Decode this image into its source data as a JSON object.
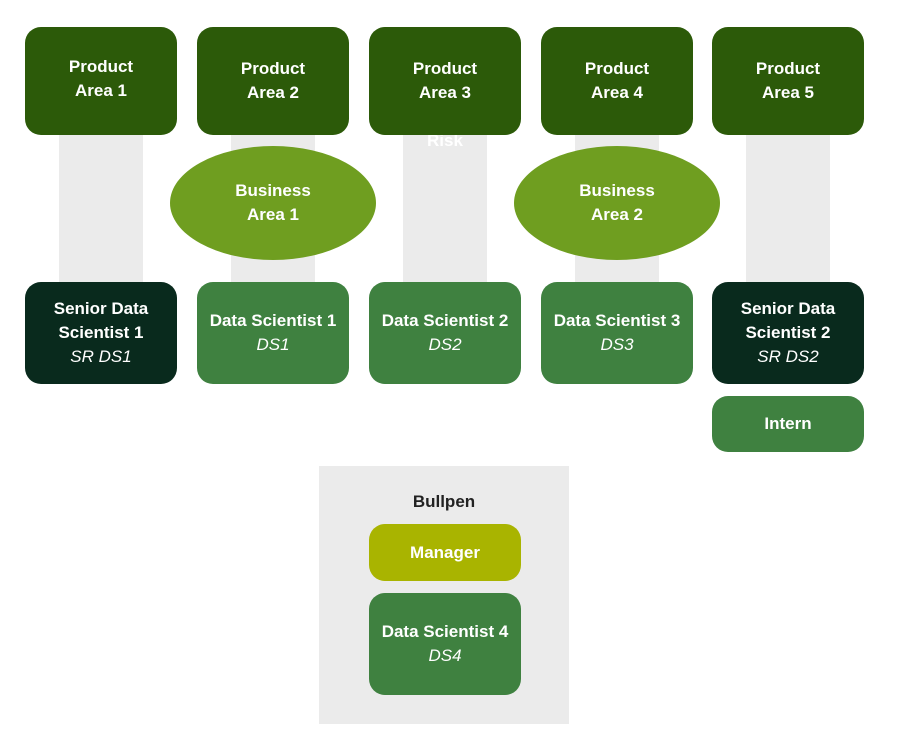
{
  "product_areas": [
    {
      "line1": "Product",
      "line2": "Area 1"
    },
    {
      "line1": "Product",
      "line2": "Area 2"
    },
    {
      "line1": "Product",
      "line2": "Area 3"
    },
    {
      "line1": "Product",
      "line2": "Area 4"
    },
    {
      "line1": "Product",
      "line2": "Area 5"
    }
  ],
  "hidden_label": "Risk",
  "business_areas": [
    {
      "line1": "Business",
      "line2": "Area 1"
    },
    {
      "line1": "Business",
      "line2": "Area 2"
    }
  ],
  "people": [
    {
      "title": "Senior Data Scientist 1",
      "code": "SR DS1"
    },
    {
      "title": "Data Scientist 1",
      "code": "DS1"
    },
    {
      "title": "Data Scientist 2",
      "code": "DS2"
    },
    {
      "title": "Data Scientist 3",
      "code": "DS3"
    },
    {
      "title": "Senior Data Scientist 2",
      "code": "SR DS2"
    }
  ],
  "intern": "Intern",
  "bullpen": {
    "title": "Bullpen",
    "manager": "Manager",
    "member": {
      "title": "Data Scientist 4",
      "code": "DS4"
    }
  },
  "colors": {
    "product": "#2c5a09",
    "business": "#6f9e20",
    "ds": "#3f8140",
    "senior": "#092a1d",
    "manager": "#a9b400",
    "lane": "#ebebeb"
  }
}
